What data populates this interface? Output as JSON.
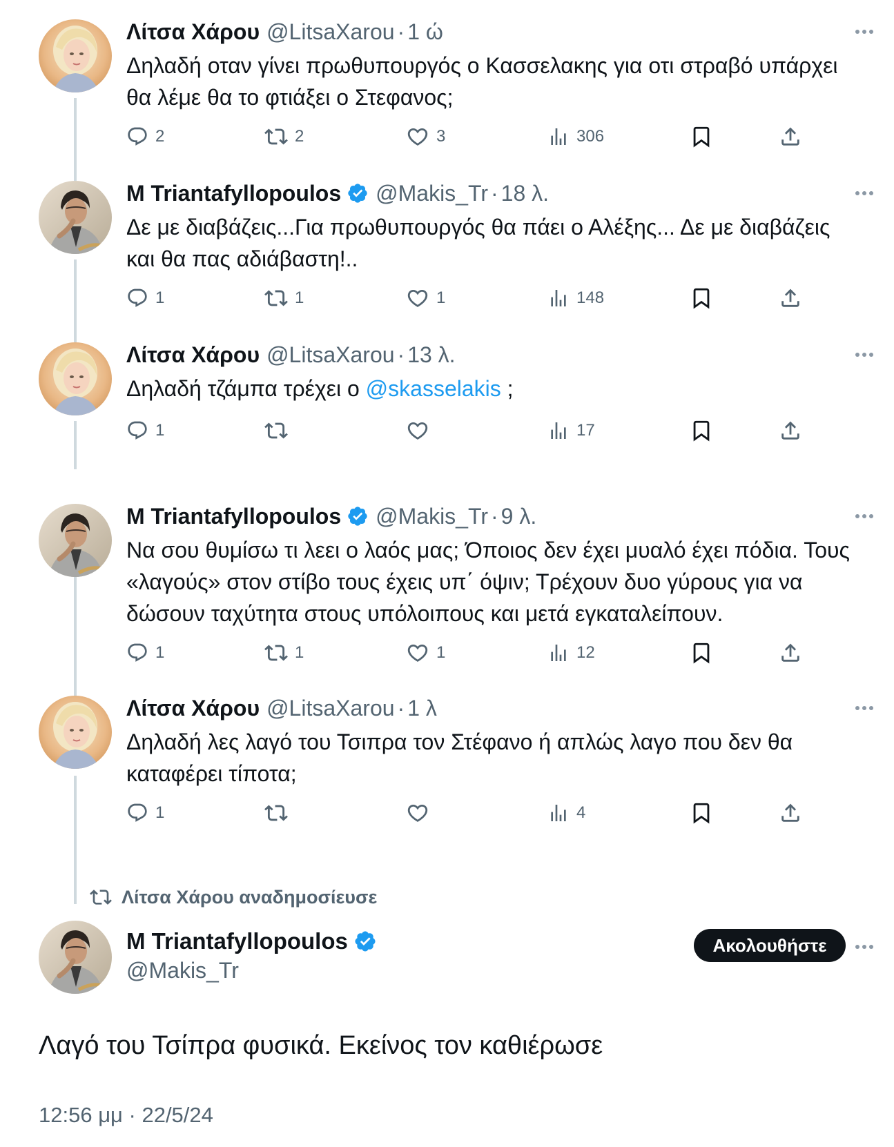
{
  "tweets": [
    {
      "name": "Λίτσα Χάρου",
      "handle": "@LitsaXarou",
      "sep": "·",
      "time": "1 ώ",
      "verified": false,
      "avatar": "avatar-litsa",
      "text_parts": [
        "Δηλαδή οταν γίνει πρωθυπουργός ο Κασσελακης για οτι στραβό υπάρχει θα λέμε θα το φτιάξει ο Στεφανος;"
      ],
      "replies": "2",
      "reposts": "2",
      "likes": "3",
      "views": "306"
    },
    {
      "name": "M Triantafyllopoulos",
      "handle": "@Makis_Tr",
      "sep": "·",
      "time": "18 λ.",
      "verified": true,
      "avatar": "avatar-makis",
      "text_parts": [
        "Δε με διαβάζεις...Για πρωθυπουργός θα πάει ο Αλέξης... Δε με διαβάζεις και θα πας αδιάβαστη!.."
      ],
      "replies": "1",
      "reposts": "1",
      "likes": "1",
      "views": "148"
    },
    {
      "name": "Λίτσα Χάρου",
      "handle": "@LitsaXarou",
      "sep": "·",
      "time": "13 λ.",
      "verified": false,
      "avatar": "avatar-litsa",
      "text_before": "Δηλαδή τζάμπα τρέχει ο ",
      "mention": "@skasselakis",
      "text_after": " ;",
      "replies": "1",
      "reposts": "",
      "likes": "",
      "views": "17"
    },
    {
      "name": "M Triantafyllopoulos",
      "handle": "@Makis_Tr",
      "sep": "·",
      "time": "9 λ.",
      "verified": true,
      "avatar": "avatar-makis",
      "text_parts": [
        "Να σου θυμίσω τι λεει ο λαός μας; Όποιος δεν έχει μυαλό έχει πόδια. Τους «λαγούς» στον στίβο τους έχεις υπ΄ όψιν; Τρέχουν δυο γύρους για να δώσουν ταχύτητα στους υπόλοιπους και μετά εγκαταλείπουν."
      ],
      "replies": "1",
      "reposts": "1",
      "likes": "1",
      "views": "12"
    },
    {
      "name": "Λίτσα Χάρου",
      "handle": "@LitsaXarou",
      "sep": "·",
      "time": "1 λ",
      "verified": false,
      "avatar": "avatar-litsa",
      "text_parts": [
        "Δηλαδή λες λαγό του Τσιπρα τον Στέφανο ή απλώς λαγο που δεν θα καταφέρει τίποτα;"
      ],
      "replies": "1",
      "reposts": "",
      "likes": "",
      "views": "4"
    }
  ],
  "repost_notice": "Λίτσα Χάρου αναδημοσίευσε",
  "main_tweet": {
    "name": "M Triantafyllopoulos",
    "handle": "@Makis_Tr",
    "follow_label": "Ακολουθήστε",
    "text": "Λαγό του Τσίπρα φυσικά. Εκείνος τον καθιέρωσε",
    "timestamp": "12:56 μμ · 22/5/24"
  },
  "colors": {
    "text": "#0f1419",
    "secondary": "#536471",
    "accent": "#1d9bf0",
    "thread_line": "#cfd9de"
  },
  "icons": [
    "reply-icon",
    "repost-icon",
    "like-icon",
    "views-icon",
    "bookmark-icon",
    "share-icon",
    "verified-icon",
    "more-icon"
  ]
}
